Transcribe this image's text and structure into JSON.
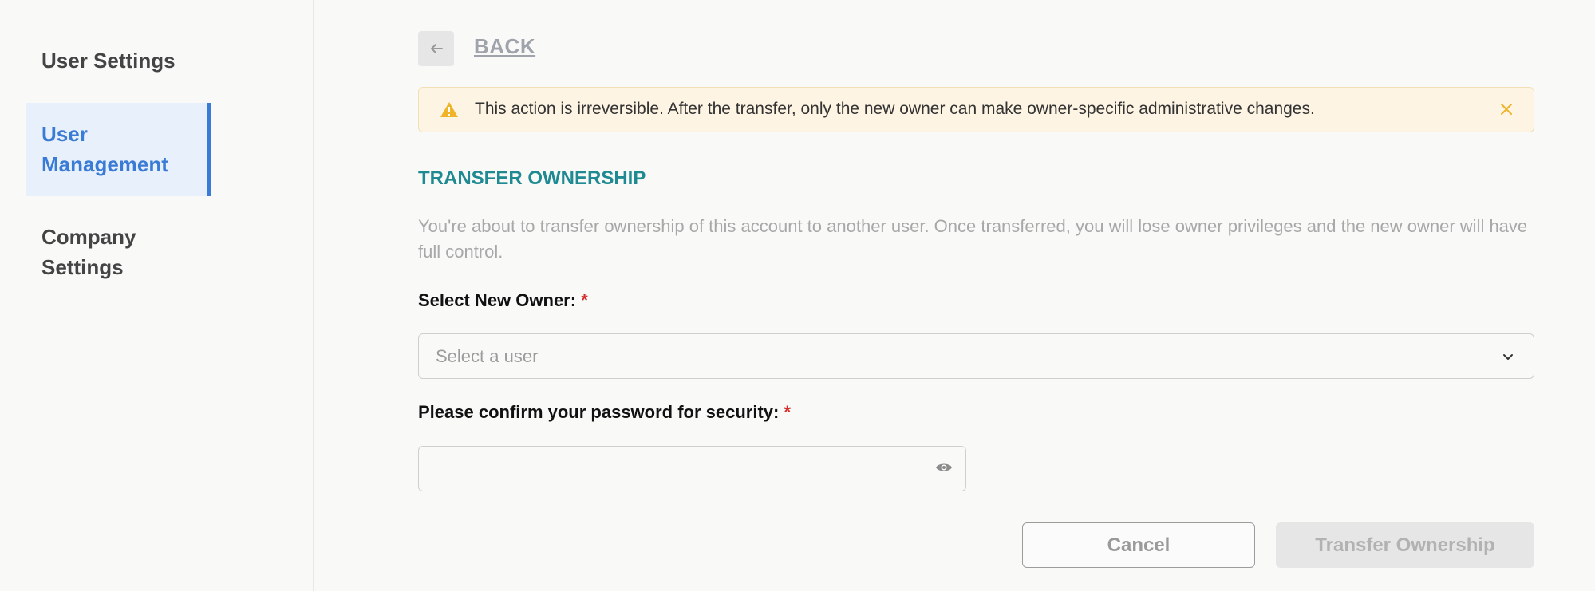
{
  "sidebar": {
    "items": [
      {
        "label": "User Settings",
        "active": false
      },
      {
        "label": "User Management",
        "active": true
      },
      {
        "label": "Company Settings",
        "active": false
      }
    ]
  },
  "header": {
    "back_label": "BACK"
  },
  "alert": {
    "text": "This action is irreversible. After the transfer, only the new owner can make owner-specific administrative changes.",
    "icon": "warning-icon",
    "close_icon": "close-icon"
  },
  "form": {
    "title": "TRANSFER OWNERSHIP",
    "description": "You're about to transfer ownership of this account to another user. Once transferred, you will lose owner privileges and the new owner will have full control.",
    "owner_label": "Select New Owner:",
    "owner_placeholder": "Select a user",
    "password_label": "Please confirm your password for security:",
    "password_value": "",
    "required_marker": "*"
  },
  "actions": {
    "cancel_label": "Cancel",
    "transfer_label": "Transfer Ownership"
  },
  "colors": {
    "accent": "#3a7bd5",
    "title": "#1f8a91",
    "alert_bg": "#fdf4e3",
    "warning": "#f0b429",
    "required": "#d32f2f"
  }
}
